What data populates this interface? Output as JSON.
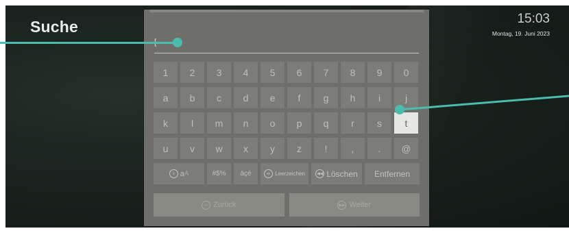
{
  "header": {
    "title": "Suche"
  },
  "clock": {
    "time": "15:03",
    "date": "Montag, 19. Juni 2023"
  },
  "search": {
    "cursor": "["
  },
  "keyboard": {
    "row1": [
      "1",
      "2",
      "3",
      "4",
      "5",
      "6",
      "7",
      "8",
      "9",
      "0"
    ],
    "row2": [
      "a",
      "b",
      "c",
      "d",
      "e",
      "f",
      "g",
      "h",
      "i",
      "j"
    ],
    "row3": [
      "k",
      "l",
      "m",
      "n",
      "o",
      "p",
      "q",
      "r",
      "s",
      "t"
    ],
    "row4": [
      "u",
      "v",
      "w",
      "x",
      "y",
      "z",
      "!",
      ",",
      ".",
      "@"
    ],
    "focused_key": "t",
    "shift_label_lower": "a",
    "shift_label_upper": "A",
    "symbols_label": "#$%",
    "accents_label": "äçé",
    "space_label": "Leerzeichen",
    "backspace_label": "Löschen",
    "delete_label": "Entfernen"
  },
  "nav": {
    "back_label": "Zurück",
    "next_label": "Weiter"
  },
  "colors": {
    "callout": "#4bbcad",
    "panel": "#6e6f6a",
    "key": "#7c7d78",
    "focused_key": "#e6e6e4"
  }
}
